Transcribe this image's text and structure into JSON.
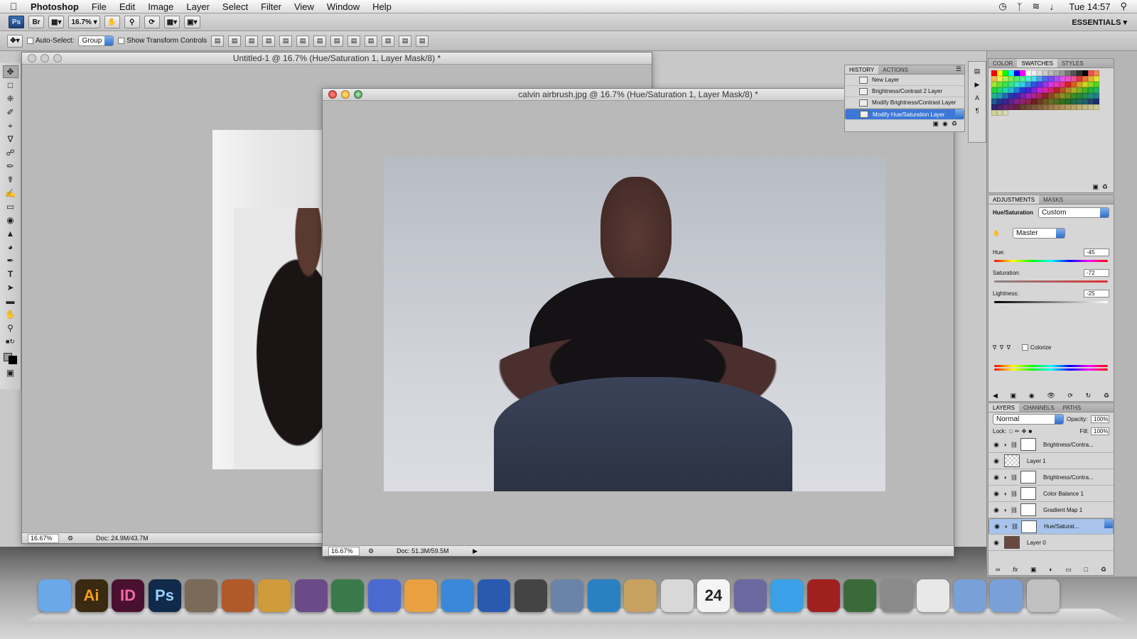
{
  "menubar": {
    "app_name": "Photoshop",
    "menus": [
      "File",
      "Edit",
      "Image",
      "Layer",
      "Select",
      "Filter",
      "View",
      "Window",
      "Help"
    ],
    "clock": "Tue 14:57",
    "status_icons": [
      "time-machine-icon",
      "bluetooth-icon",
      "wifi-icon",
      "volume-icon",
      "spotlight-icon"
    ]
  },
  "appbar": {
    "ps_badge": "Ps",
    "br_badge": "Br",
    "zoom": "16.7%",
    "workspace": "ESSENTIALS"
  },
  "options": {
    "auto_select_label": "Auto-Select:",
    "auto_select_value": "Group",
    "show_transform_label": "Show Transform Controls"
  },
  "doc_back": {
    "title": "Untitled-1 @ 16.7% (Hue/Saturation 1, Layer Mask/8) *",
    "zoom": "16.67%",
    "doc_size": "Doc: 24.9M/43.7M"
  },
  "doc_front": {
    "title": "calvin airbrush.jpg @ 16.7% (Hue/Saturation 1, Layer Mask/8) *",
    "zoom": "16.67%",
    "doc_size": "Doc: 51.3M/59.5M"
  },
  "history": {
    "tabs": [
      "HISTORY",
      "ACTIONS"
    ],
    "items": [
      "New Layer",
      "Brightness/Contrast 2 Layer",
      "Modify Brightness/Contrast Layer",
      "Modify Hue/Saturation Layer"
    ],
    "selected_index": 3
  },
  "swatches": {
    "tabs": [
      "COLOR",
      "SWATCHES",
      "STYLES"
    ]
  },
  "adjustments": {
    "tabs": [
      "ADJUSTMENTS",
      "MASKS"
    ],
    "type_label": "Hue/Saturation",
    "preset": "Custom",
    "channel": "Master",
    "hue_label": "Hue:",
    "hue_value": "-45",
    "saturation_label": "Saturation:",
    "saturation_value": "-72",
    "lightness_label": "Lightness:",
    "lightness_value": "-25",
    "colorize_label": "Colorize"
  },
  "layers": {
    "tabs": [
      "LAYERS",
      "CHANNELS",
      "PATHS"
    ],
    "blend_mode": "Normal",
    "opacity_label": "Opacity:",
    "opacity": "100%",
    "lock_label": "Lock:",
    "fill_label": "Fill:",
    "fill": "100%",
    "items": [
      {
        "name": "Brightness/Contra...",
        "kind": "adjustment"
      },
      {
        "name": "Layer 1",
        "kind": "pixel"
      },
      {
        "name": "Brightness/Contra...",
        "kind": "adjustment"
      },
      {
        "name": "Color Balance 1",
        "kind": "adjustment"
      },
      {
        "name": "Gradient Map 1",
        "kind": "adjustment"
      },
      {
        "name": "Hue/Saturat...",
        "kind": "adjustment"
      },
      {
        "name": "Layer 0",
        "kind": "pixel"
      }
    ],
    "selected_index": 5
  },
  "dock": {
    "icons": [
      "finder-icon",
      "illustrator-icon",
      "indesign-icon",
      "photoshop-icon",
      "imovie-icon",
      "garageband-icon",
      "gnome-icon",
      "iphoto-icon",
      "imovie-star-icon",
      "quill-icon",
      "numbers-icon",
      "keynote-icon",
      "safari-icon",
      "app-store-icon",
      "dashboard-icon",
      "preview-icon",
      "facetime-icon",
      "address-book-icon",
      "ical-icon",
      "photo-booth-icon",
      "itunes-icon",
      "theater-icon",
      "time-machine-icon",
      "system-preferences-icon",
      "document-icon",
      "folder-icon",
      "applications-folder-icon",
      "trash-icon"
    ],
    "labels": {
      "ai": "Ai",
      "id": "ID",
      "ps": "Ps",
      "cal": "24"
    }
  }
}
